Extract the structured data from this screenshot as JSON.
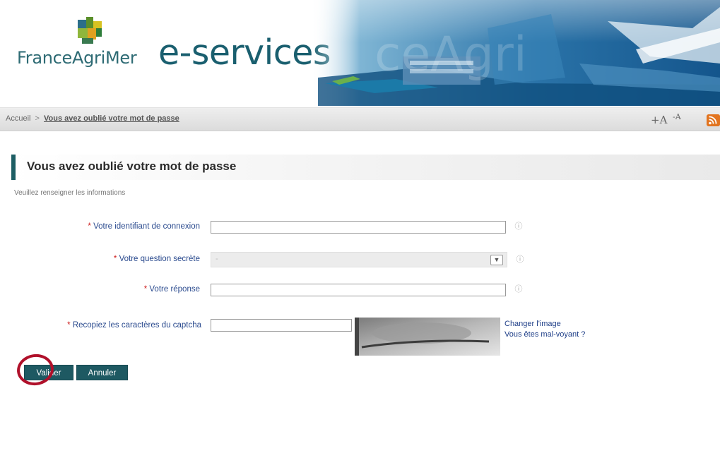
{
  "header": {
    "brand_name": "FranceAgriMer",
    "app_title": "e-services"
  },
  "breadcrumb": {
    "home": "Accueil",
    "separator": ">",
    "current": "Vous avez oublié votre mot de passe"
  },
  "accessibility": {
    "font_increase": "+A",
    "font_decrease": "-A",
    "rss_icon": "rss-icon"
  },
  "page": {
    "title": "Vous avez oublié votre mot de passe",
    "intro": "Veuillez renseigner les informations"
  },
  "form": {
    "required_marker": "*",
    "identifiant": {
      "label": "Votre identifiant de connexion",
      "value": ""
    },
    "question": {
      "label": "Votre question secrète",
      "selected": "-"
    },
    "reponse": {
      "label": "Votre réponse",
      "value": ""
    },
    "captcha": {
      "label": "Recopiez les caractères du captcha",
      "value": "",
      "change_link": "Changer l'image",
      "audio_link": "Vous êtes mal-voyant ?"
    }
  },
  "buttons": {
    "submit": "Valider",
    "cancel": "Annuler"
  },
  "colors": {
    "primary": "#1e5962",
    "brand_text": "#1a5f6f",
    "label_blue": "#2a4a8e",
    "required_red": "#cc1b1b",
    "highlight": "#b0102a"
  }
}
